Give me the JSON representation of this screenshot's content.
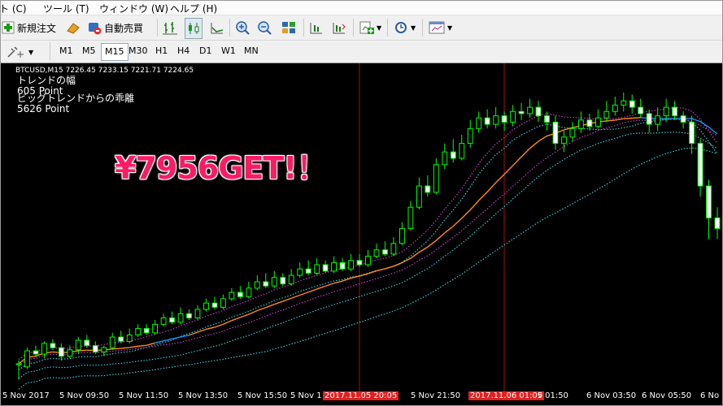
{
  "menu": {
    "items": [
      "ト (C)",
      "ツール (T)",
      "ウィンドウ (W)",
      "ヘルプ (H)"
    ]
  },
  "toolbar": {
    "new_order": "新規注文",
    "auto_trade": "自動売買"
  },
  "timeframes": [
    "M1",
    "M5",
    "M15",
    "M30",
    "H1",
    "H4",
    "D1",
    "W1",
    "MN"
  ],
  "timeframe_selected": "M15",
  "chart": {
    "symbol_line": "BTCUSD,M15  7226.45 7233.15 7221.71 7224.65",
    "indicator_lines": [
      "トレンドの幅",
      "605 Point",
      "ビッグトレンドからの乖離",
      "5626 Point"
    ],
    "overlay_big": "¥7956GET!！",
    "time_labels": [
      "5 Nov 2017",
      "5 Nov 09:50",
      "5 Nov 11:50",
      "5 Nov 13:50",
      "5 Nov 15:50",
      "5 Nov 1",
      "2017.11.05 20:05",
      "5 Nov 21:50",
      "2017.11.06 01:05",
      "v 01:50",
      "6 Nov 03:50",
      "6 Nov 05:50",
      "6 No"
    ],
    "colors": {
      "bull": "#00ff00",
      "bear": "#ffffff",
      "ma_orange": "#ff8c1a",
      "ma_blue": "#1e90ff",
      "dots_cyan": "#40c8d0",
      "dots_magenta": "#c040c0",
      "vline": "#a01010",
      "overlay": "#ff1a64"
    }
  },
  "chart_data": {
    "type": "candlestick",
    "title": "BTCUSD,M15",
    "bars": [
      [
        62,
        63,
        66,
        48
      ],
      [
        60,
        75,
        78,
        58
      ],
      [
        75,
        72,
        80,
        70
      ],
      [
        72,
        82,
        84,
        68
      ],
      [
        82,
        78,
        86,
        76
      ],
      [
        78,
        70,
        82,
        66
      ],
      [
        70,
        76,
        80,
        68
      ],
      [
        76,
        85,
        88,
        72
      ],
      [
        85,
        80,
        90,
        78
      ],
      [
        80,
        74,
        84,
        72
      ],
      [
        74,
        78,
        80,
        70
      ],
      [
        78,
        88,
        92,
        76
      ],
      [
        88,
        84,
        94,
        82
      ],
      [
        84,
        90,
        96,
        82
      ],
      [
        90,
        96,
        100,
        88
      ],
      [
        96,
        92,
        100,
        90
      ],
      [
        92,
        100,
        104,
        90
      ],
      [
        100,
        106,
        110,
        98
      ],
      [
        106,
        102,
        112,
        100
      ],
      [
        102,
        110,
        116,
        100
      ],
      [
        110,
        106,
        114,
        104
      ],
      [
        106,
        114,
        118,
        104
      ],
      [
        114,
        120,
        124,
        112
      ],
      [
        120,
        116,
        126,
        114
      ],
      [
        116,
        124,
        128,
        114
      ],
      [
        124,
        130,
        134,
        122
      ],
      [
        130,
        126,
        136,
        124
      ],
      [
        126,
        134,
        140,
        124
      ],
      [
        134,
        140,
        146,
        132
      ],
      [
        140,
        136,
        148,
        134
      ],
      [
        136,
        144,
        150,
        134
      ],
      [
        144,
        138,
        148,
        136
      ],
      [
        138,
        146,
        152,
        136
      ],
      [
        146,
        152,
        158,
        144
      ],
      [
        152,
        148,
        160,
        146
      ],
      [
        148,
        156,
        162,
        146
      ],
      [
        156,
        150,
        160,
        148
      ],
      [
        150,
        158,
        164,
        148
      ],
      [
        158,
        152,
        162,
        150
      ],
      [
        152,
        160,
        166,
        150
      ],
      [
        160,
        156,
        166,
        154
      ],
      [
        156,
        164,
        170,
        154
      ],
      [
        164,
        170,
        176,
        162
      ],
      [
        170,
        166,
        178,
        164
      ],
      [
        166,
        176,
        182,
        164
      ],
      [
        176,
        190,
        196,
        174
      ],
      [
        190,
        210,
        216,
        188
      ],
      [
        210,
        230,
        238,
        208
      ],
      [
        230,
        224,
        240,
        220
      ],
      [
        224,
        250,
        256,
        222
      ],
      [
        250,
        262,
        270,
        246
      ],
      [
        262,
        256,
        274,
        252
      ],
      [
        256,
        270,
        278,
        254
      ],
      [
        270,
        284,
        292,
        266
      ],
      [
        284,
        294,
        300,
        280
      ],
      [
        294,
        288,
        302,
        284
      ],
      [
        288,
        296,
        304,
        284
      ],
      [
        296,
        290,
        300,
        282
      ],
      [
        290,
        300,
        306,
        286
      ],
      [
        300,
        298,
        308,
        292
      ],
      [
        298,
        304,
        312,
        294
      ],
      [
        304,
        296,
        310,
        290
      ],
      [
        296,
        290,
        300,
        282
      ],
      [
        290,
        270,
        296,
        264
      ],
      [
        270,
        276,
        282,
        262
      ],
      [
        276,
        284,
        290,
        272
      ],
      [
        284,
        292,
        300,
        280
      ],
      [
        292,
        286,
        298,
        282
      ],
      [
        286,
        294,
        302,
        284
      ],
      [
        294,
        300,
        310,
        290
      ],
      [
        300,
        306,
        314,
        296
      ],
      [
        306,
        310,
        318,
        300
      ],
      [
        310,
        304,
        316,
        298
      ],
      [
        304,
        298,
        312,
        294
      ],
      [
        298,
        288,
        302,
        280
      ],
      [
        288,
        296,
        304,
        282
      ],
      [
        296,
        304,
        312,
        290
      ],
      [
        304,
        296,
        310,
        292
      ],
      [
        296,
        290,
        300,
        284
      ],
      [
        290,
        270,
        296,
        260
      ],
      [
        270,
        230,
        274,
        220
      ],
      [
        230,
        200,
        236,
        180
      ],
      [
        200,
        190,
        210,
        180
      ]
    ],
    "ylim": [
      40,
      330
    ]
  }
}
